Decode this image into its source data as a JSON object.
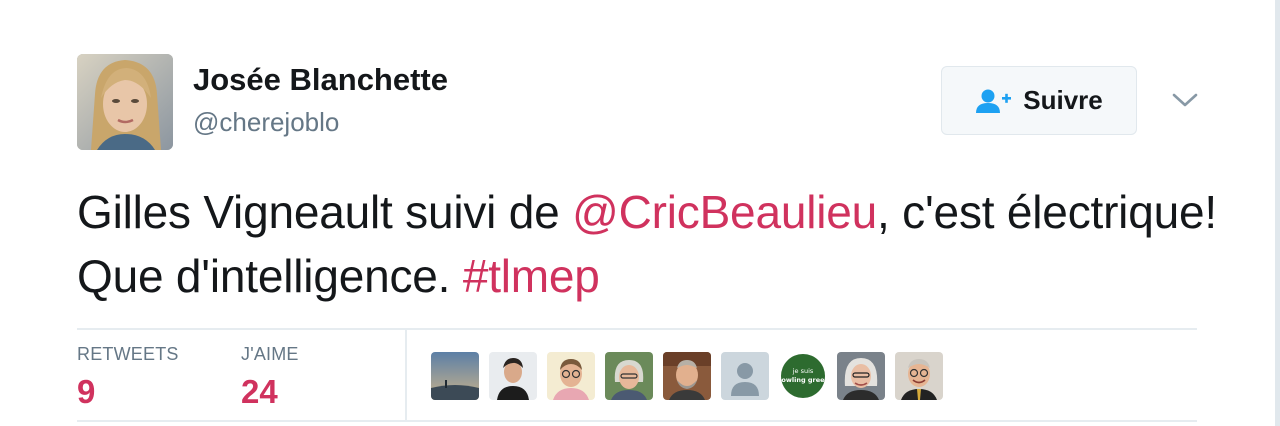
{
  "author": {
    "display_name": "Josée Blanchette",
    "handle": "@cherejoblo",
    "avatar_icon": "profile-photo"
  },
  "follow_button": {
    "label": "Suivre",
    "icon": "add-user-icon"
  },
  "more_menu": {
    "icon": "chevron-down-icon"
  },
  "tweet": {
    "text_part_1": "Gilles Vigneault suivi de ",
    "mention": "@CricBeaulieu",
    "text_part_2": ", c'est électrique! Que d'intelligence. ",
    "hashtag": "#tlmep"
  },
  "stats": {
    "retweets_label": "RETWEETS",
    "retweets_count": "9",
    "likes_label": "J'AIME",
    "likes_count": "24"
  },
  "likers": [
    {
      "icon": "liker-avatar-landscape"
    },
    {
      "icon": "liker-avatar-man-dark-hair"
    },
    {
      "icon": "liker-avatar-man-glasses"
    },
    {
      "icon": "liker-avatar-woman-glasses"
    },
    {
      "icon": "liker-avatar-man-beard"
    },
    {
      "icon": "liker-avatar-default-egg"
    },
    {
      "icon": "liker-avatar-bowling-green-logo",
      "logo_text_1": "je suis",
      "logo_text_2": "bowling green"
    },
    {
      "icon": "liker-avatar-woman-gray-hair"
    },
    {
      "icon": "liker-avatar-man-glasses-smiling"
    }
  ],
  "colors": {
    "link": "#d0325e",
    "text": "#14171a",
    "secondary_text": "#657786",
    "follow_icon": "#1da1f2"
  }
}
